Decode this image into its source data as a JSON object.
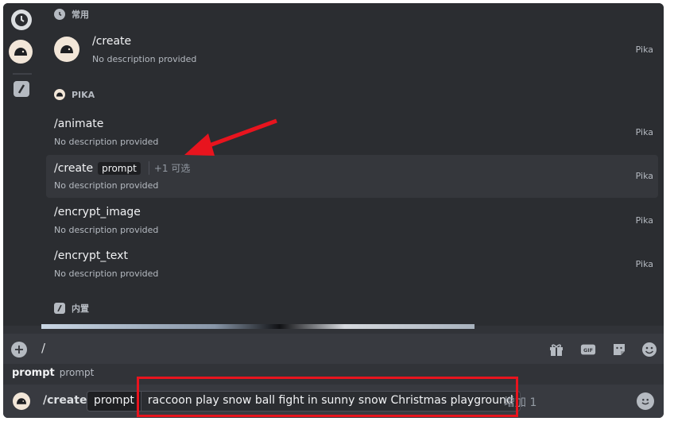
{
  "sections": {
    "frequent": {
      "title": "常用"
    },
    "pika": {
      "title": "PIKA"
    },
    "builtin": {
      "title": "内置"
    }
  },
  "frequent_command": {
    "name": "/create",
    "description": "No description provided",
    "source": "Pika"
  },
  "pika_commands": [
    {
      "name": "/animate",
      "description": "No description provided",
      "source": "Pika"
    },
    {
      "name": "/create",
      "option": "prompt",
      "more": "+1 可选",
      "description": "No description provided",
      "source": "Pika",
      "selected": true
    },
    {
      "name": "/encrypt_image",
      "description": "No description provided",
      "source": "Pika"
    },
    {
      "name": "/encrypt_text",
      "description": "No description provided",
      "source": "Pika"
    }
  ],
  "command_bar": {
    "text": "/"
  },
  "tools": [
    "gift-icon",
    "gif-icon",
    "sticker-icon",
    "emoji-icon"
  ],
  "gif_label": "GIF",
  "option_hint": {
    "name": "prompt",
    "description": "prompt"
  },
  "input": {
    "command": "/create",
    "option_name": "prompt",
    "option_value": "raccoon play snow ball fight in sunny snow Christmas playground",
    "extra": "增加 1"
  },
  "colors": {
    "highlight": "#e8141e",
    "background": "#313338",
    "panel": "#2b2d31"
  }
}
